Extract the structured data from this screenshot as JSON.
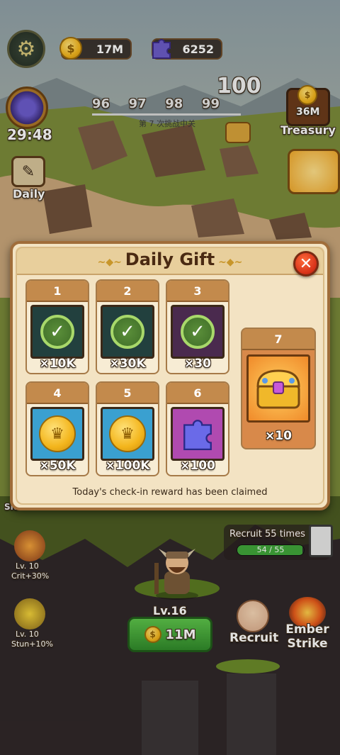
{
  "hud": {
    "gold": "17M",
    "puzzle": "6252",
    "timer": "29:48",
    "daily_label": "Daily",
    "treasury_amount": "36M",
    "treasury_label": "Treasury"
  },
  "stage": {
    "current": "100",
    "levels": [
      "96",
      "97",
      "98",
      "99"
    ],
    "subtitle": "第 7 次挑战中关"
  },
  "dialog": {
    "title": "Daily Gift",
    "note": "Today's check-in reward has been claimed",
    "days": [
      {
        "day": "1",
        "amount": "×10K",
        "claimed": true
      },
      {
        "day": "2",
        "amount": "×30K",
        "claimed": true
      },
      {
        "day": "3",
        "amount": "×30",
        "claimed": true
      },
      {
        "day": "4",
        "amount": "×50K",
        "claimed": false
      },
      {
        "day": "5",
        "amount": "×100K",
        "claimed": false
      },
      {
        "day": "6",
        "amount": "×100",
        "claimed": false
      },
      {
        "day": "7",
        "amount": "×10",
        "claimed": false
      }
    ]
  },
  "bottom": {
    "slot_label": "Slo",
    "skill1_level": "Lv. 10",
    "skill1_effect": "Crit+30%",
    "skill2_level": "Lv. 10",
    "skill2_effect": "Stun+10%",
    "recruit_times": "Recruit 55 times",
    "recruit_progress": "54 / 55",
    "recruit_fraction": 0.98,
    "hero_level": "Lv.16",
    "upgrade_cost": "11M",
    "recruit_label": "Recruit",
    "ember_label": "Ember Strike"
  },
  "colors": {
    "accent_green": "#3fa63a",
    "dialog_bg": "#f3e3c3",
    "close_red": "#d8341a"
  }
}
